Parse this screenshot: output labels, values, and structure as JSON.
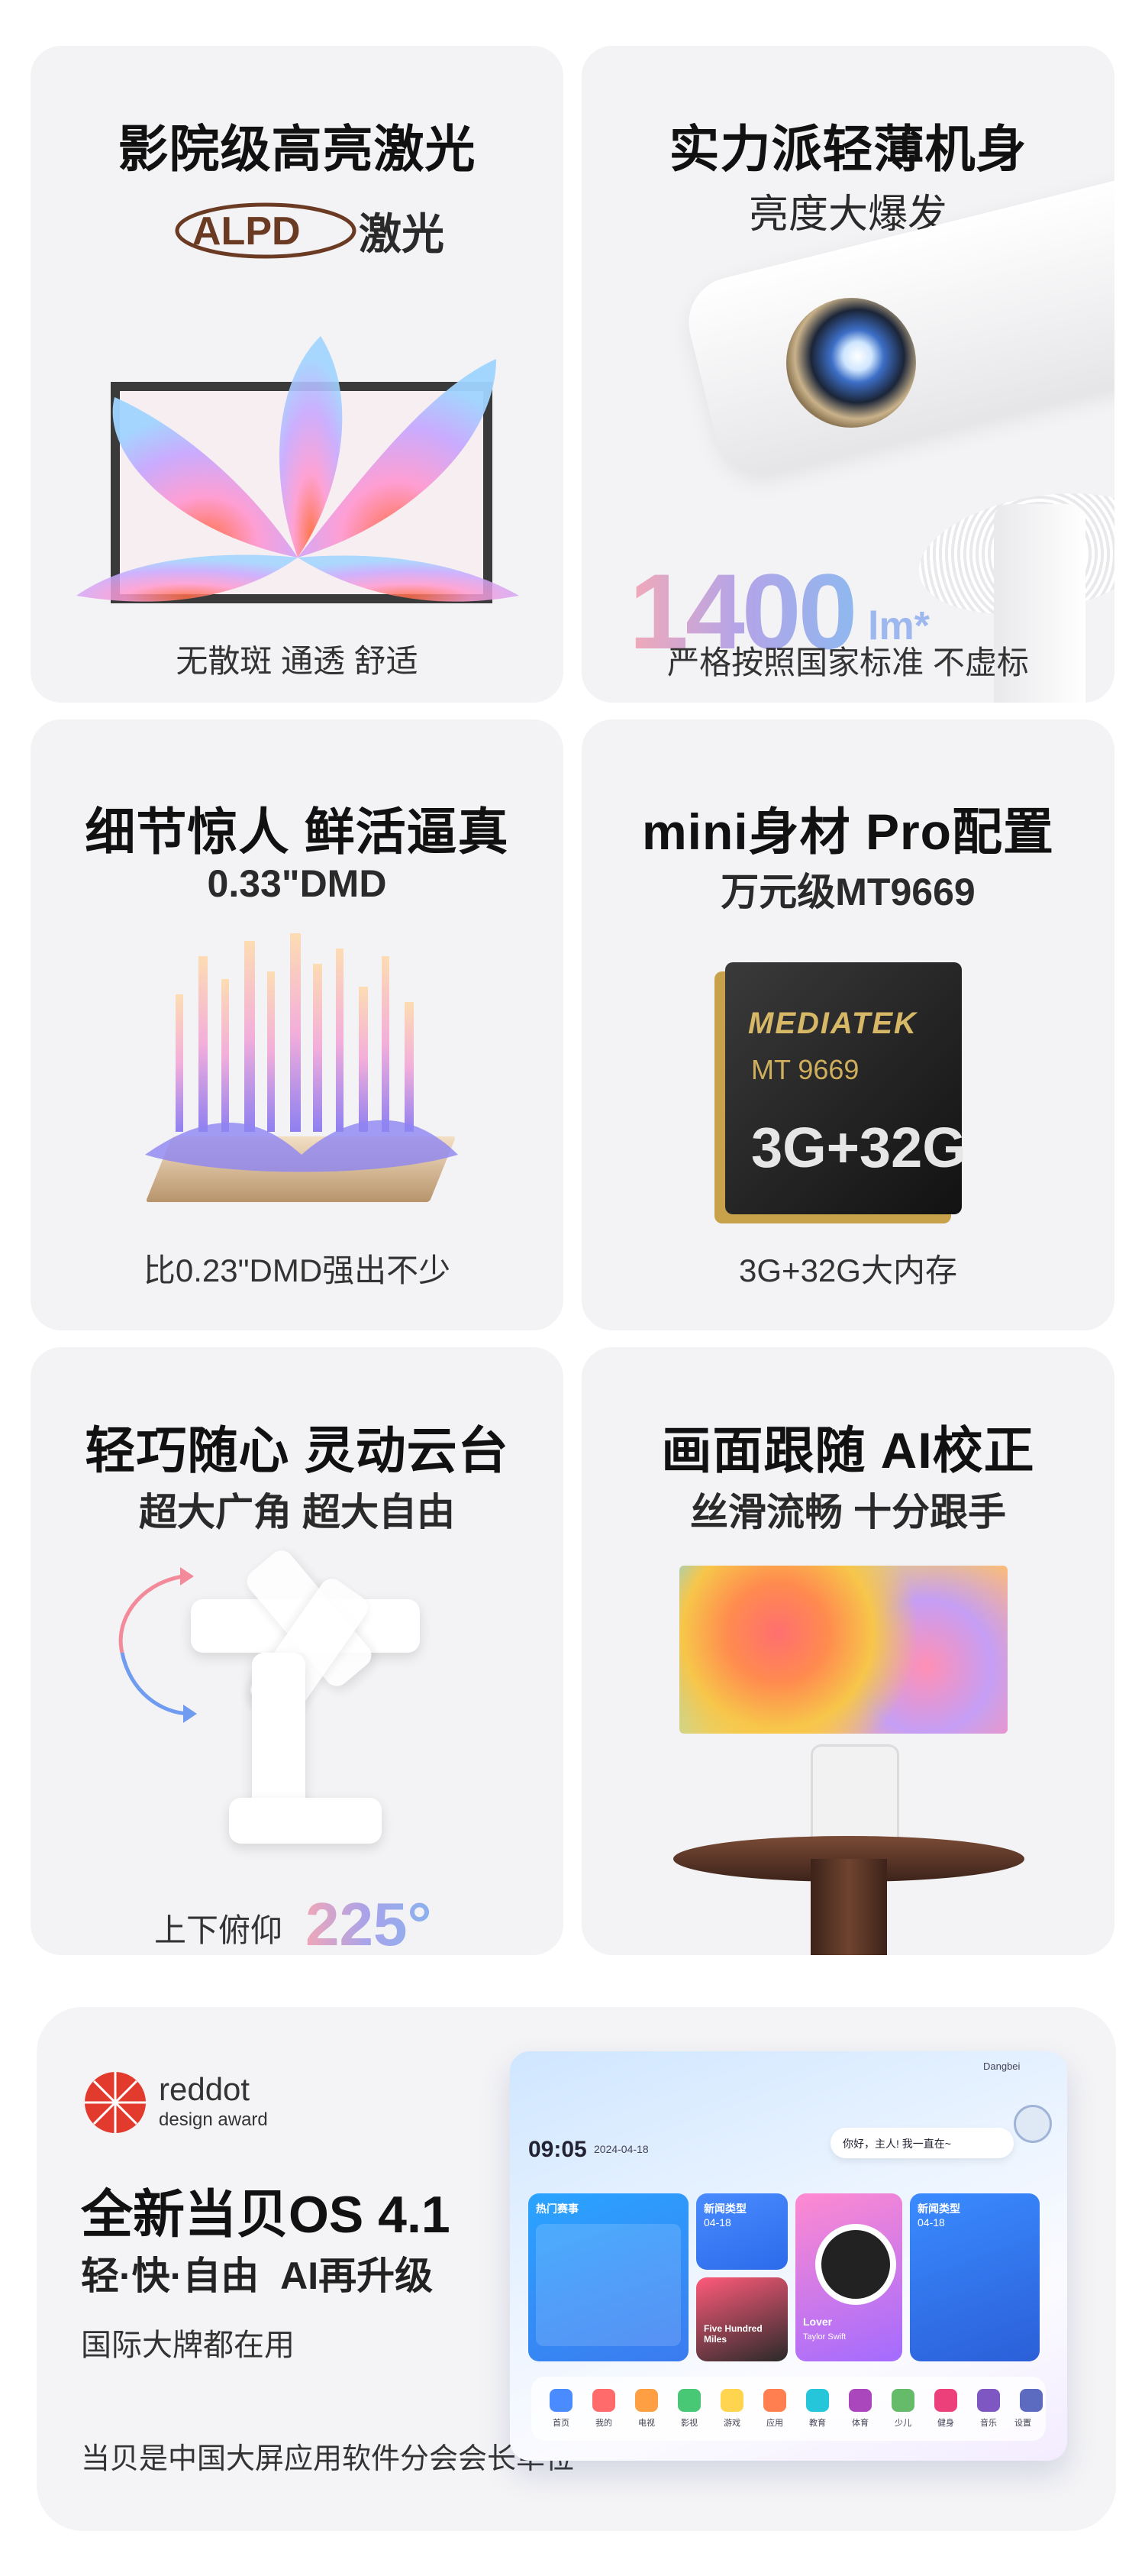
{
  "cards": {
    "c1": {
      "title": "影院级高亮激光",
      "badge_brand": "ALPD",
      "badge_suffix": "激光",
      "footer": "无散斑 通透 舒适"
    },
    "c2": {
      "title": "实力派轻薄机身",
      "subtitle": "亮度大爆发",
      "lumen_value": "1400",
      "lumen_unit": "lm*",
      "footer": "严格按照国家标准 不虚标"
    },
    "c3": {
      "title": "细节惊人 鲜活逼真",
      "subtitle": "0.33\"DMD",
      "footer": "比0.23\"DMD强出不少"
    },
    "c4": {
      "title": "mini身材 Pro配置",
      "subtitle": "万元级MT9669",
      "chip_brand": "MEDIATEK",
      "chip_model": "MT 9669",
      "chip_memory": "3G+32G",
      "footer": "3G+32G大内存"
    },
    "c5": {
      "title": "轻巧随心 灵动云台",
      "subtitle": "超大广角 超大自由",
      "footer_prefix": "上下俯仰",
      "footer_value": "225°"
    },
    "c6": {
      "title": "画面跟随 AI校正",
      "subtitle": "丝滑流畅 十分跟手"
    }
  },
  "os": {
    "award_brand": "reddot",
    "award_sub": "design award",
    "title": "全新当贝OS 4.1",
    "subtitle": "轻·快·自由  AI再升级",
    "line": "国际大牌都在用",
    "note": "当贝是中国大屏应用软件分会会长单位",
    "note_mark": "②",
    "tablet": {
      "time": "09:05",
      "date": "2024-04-18",
      "greeting": "你好，主人! 我一直在~",
      "user": "Dangbei",
      "tile1_title": "热门赛事",
      "tile2_title": "新闻类型",
      "tile2_date": "04-18",
      "tile3_title": "Lover",
      "tile3_sub": "Taylor Swift",
      "tile4_title": "新闻类型",
      "tile4_date": "04-18",
      "tile5_title": "Five Hundred Miles",
      "dock": [
        "首页",
        "我的",
        "电视",
        "影视",
        "游戏",
        "应用",
        "教育",
        "体育",
        "少儿",
        "健身",
        "音乐",
        "设置"
      ]
    }
  },
  "colors": {
    "accent_gradient_start": "#f2a9b8",
    "accent_gradient_end": "#8fb8ef",
    "card_bg": "#f3f3f5",
    "chip_gold": "#d7b867"
  }
}
